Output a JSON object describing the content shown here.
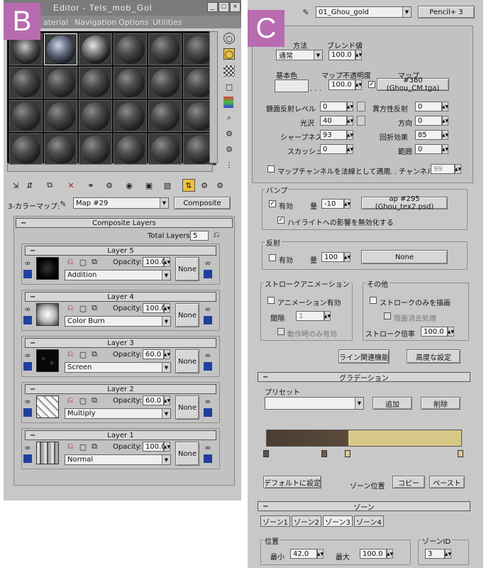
{
  "badges": {
    "left": "B",
    "right": "C"
  },
  "left": {
    "title": "Editor - Tels_mob_Gol",
    "menu": [
      "aterial",
      "Navigation",
      "Options",
      "Utilities"
    ],
    "map_label": "3-カラーマップ:",
    "map_value": "Map #29",
    "map_type": "Composite",
    "composite_header": "Composite Layers",
    "total_layers_label": "Total Layers:",
    "total_layers": "5",
    "opacity_label": "Opacity:",
    "none_label": "None",
    "layers": [
      {
        "name": "Layer 5",
        "opacity": "100.0",
        "mode": "Addition"
      },
      {
        "name": "Layer 4",
        "opacity": "100.0",
        "mode": "Color Burn"
      },
      {
        "name": "Layer 3",
        "opacity": "60.0",
        "mode": "Screen"
      },
      {
        "name": "Layer 2",
        "opacity": "60.0",
        "mode": "Multiply"
      },
      {
        "name": "Layer 1",
        "opacity": "100.0",
        "mode": "Normal"
      }
    ]
  },
  "right": {
    "material_name": "01_Ghou_gold",
    "material_type": "Pencil+ 3",
    "blend_method_label": "方法",
    "blend_method": "通常",
    "blend_value_label": "ブレンド値",
    "blend_value": "100.0",
    "base_color_label": "基本色",
    "map_opacity_label": "マップ不透明度",
    "map_label": "マップ",
    "map_opacity": "100.0",
    "map_name": "#380 (Ghou_CM.tga)",
    "spec_level_label": "鏡面反射レベル",
    "spec_level": "0",
    "aniso_label": "異方性反射",
    "aniso": "0",
    "gloss_label": "光沢",
    "gloss": "40",
    "direction_label": "方向",
    "direction": "0",
    "sharpness_label": "シャープネス",
    "sharpness": "93",
    "refraction_label": "回折効果",
    "refraction": "85",
    "squash_label": "スカッシュ",
    "squash": "0",
    "range_label": "範囲",
    "range": "0",
    "map_channel_label": "マップチャンネルを法線として適用",
    "channel_label": ". . . チャンネル",
    "channel": "99",
    "bump_group": "バンプ",
    "bump_enabled_label": "有効",
    "amount_label": "量",
    "bump_amount": "-10",
    "bump_map": "ap #295 (Ghou_tex2.psd)",
    "bump_highlight_label": "ハイライトへの影響を無効化する",
    "reflection_group": "反射",
    "reflection_enabled_label": "有効",
    "reflection_amount": "100",
    "reflection_map": "None",
    "stroke_anim_group": "ストロークアニメーション",
    "anim_enabled_label": "アニメーション有効",
    "interval_label": "間隔",
    "interval": "1",
    "move_only_label": "動作時のみ有効",
    "other_group": "その他",
    "stroke_only_label": "ストロークのみを描画",
    "hidden_remove_label": "隠面消去処理",
    "stroke_scale_label": "ストローク倍率",
    "stroke_scale": "100.0",
    "line_func_button": "ライン関連機能",
    "advanced_button": "高度な設定",
    "gradation_header": "グラデーション",
    "preset_label": "プリセット",
    "add_button": "追加",
    "delete_button": "削除",
    "default_button": "デフォルトに設定",
    "zone_pos_label": "ゾーン位置",
    "copy_button": "コピー",
    "paste_button": "ペースト",
    "zone_header": "ゾーン",
    "zone_tabs": [
      "ゾーン1",
      "ゾーン2",
      "ゾーン3",
      "ゾーン4"
    ],
    "position_group": "位置",
    "min_label": "最小",
    "min_value": "42.0",
    "max_label": "最大",
    "max_value": "100.0",
    "zone_id_group": "ゾーンID",
    "zone_id": "3",
    "colors": {
      "gradient_dark": "#4a3c30",
      "gradient_gold": "#d8c888"
    }
  }
}
